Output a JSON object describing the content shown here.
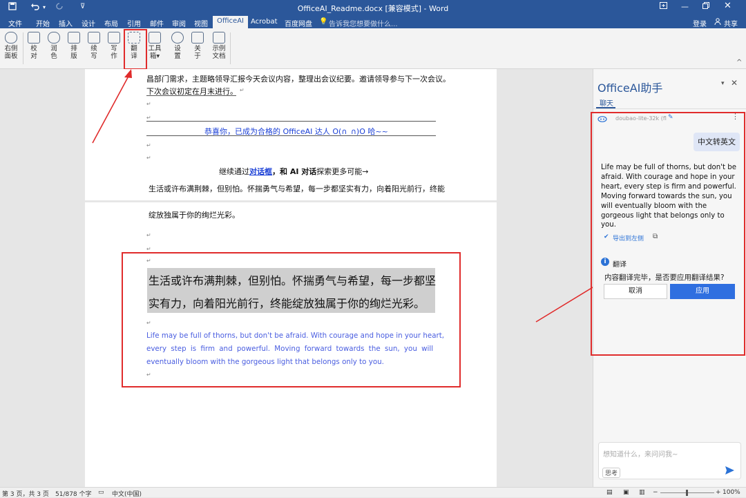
{
  "titlebar": {
    "title": "OfficeAI_Readme.docx [兼容模式] - Word",
    "save_icon": "save-icon",
    "undo_icon": "undo-icon",
    "redo_icon": "redo-icon"
  },
  "menu": {
    "file": "文件",
    "items": [
      "开始",
      "插入",
      "设计",
      "布局",
      "引用",
      "邮件",
      "审阅",
      "视图"
    ],
    "active": "OfficeAI",
    "after": [
      "Acrobat",
      "百度网盘"
    ],
    "search_placeholder": "告诉我您想要做什么...",
    "login": "登录",
    "share": "共享"
  },
  "ribbon": {
    "right_panel": "右侧\n面板",
    "buttons": [
      "校\n对",
      "润\n色",
      "排\n版",
      "续\n写",
      "写\n作",
      "翻\n译",
      "工具\n箱",
      "设\n置",
      "关\n于",
      "示例\n文档"
    ]
  },
  "doc": {
    "p1_line1": "昌部门需求，主题略领导汇报今天会议内容，整理出会议纪要。邀请领导参与下一次会议。",
    "p1_line2": "下次会议初定在月末进行。",
    "congrats": "恭喜你，已成为合格的 OfficeAI 达人 O(∩_∩)O 哈~~",
    "continue_pre": "继续通过",
    "continue_link": "对话框",
    "continue_mid": "，和 AI 对话",
    "continue_post": "探索更多可能→",
    "p1_last": "生活或许布满荆棘，但别怕。怀揣勇气与希望，每一步都坚实有力，向着阳光前行，终能",
    "p2_first": "绽放独属于你的绚烂光彩。",
    "big_line1": "生活或许布满荆棘，但别怕。怀揣勇气与希望，每一步都坚",
    "big_line2": "实有力，向着阳光前行，终能绽放独属于你的绚烂光彩。",
    "en_line1": "Life may be full of thorns, but don't be afraid. With courage and hope in your heart,",
    "en_line2": "every step is firm and powerful. Moving forward towards the sun, you will",
    "en_line3": "eventually bloom with the gorgeous light that belongs only to you."
  },
  "sidebar": {
    "title": "OfficeAI助手",
    "tab": "聊天",
    "model": "doubao-lite-32k (fl",
    "user_msg": "中文转英文",
    "reply": "Life may be full of thorns, but don't be afraid. With courage and hope in your heart, every step is firm and powerful. Moving forward towards the sun, you will eventually bloom with the gorgeous light that belongs only to you.",
    "export": "导出到左侧",
    "translate_title": "翻译",
    "translate_msg": "内容翻译完毕，是否要应用翻译结果?",
    "cancel": "取消",
    "apply": "应用",
    "input_placeholder": "想知道什么，来问问我~",
    "think": "思考"
  },
  "status": {
    "page": "第 3 页，共 3 页",
    "words": "51/878 个字",
    "lang": "中文(中国)",
    "zoom": "100%"
  },
  "colors": {
    "title_bar": "#2b579a",
    "highlight_red": "#e02b2b",
    "link_blue": "#1a3fd6",
    "translation_blue": "#4a5ee0",
    "apply_button": "#2f6fe0",
    "user_bubble": "#dfe6f6"
  }
}
